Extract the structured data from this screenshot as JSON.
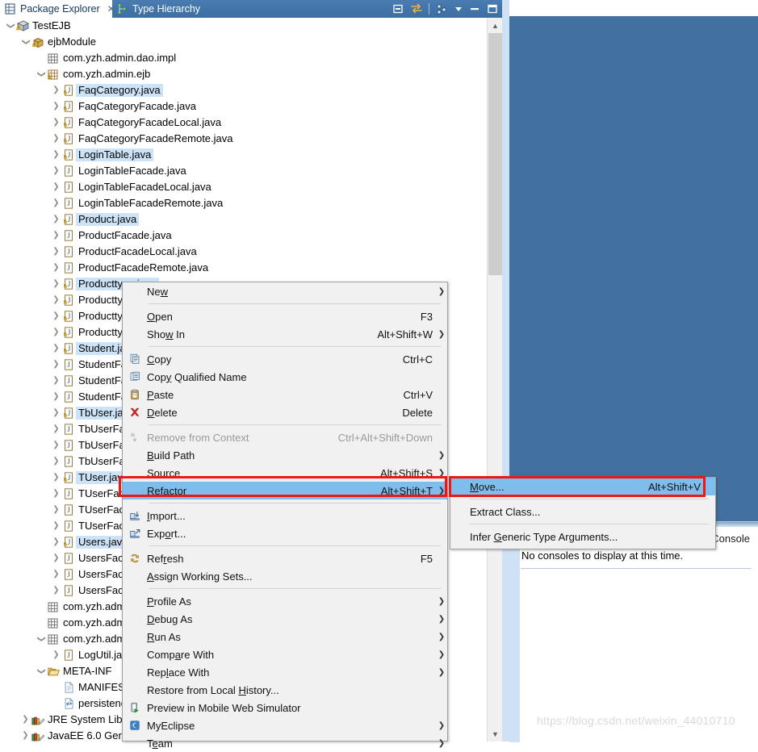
{
  "tabs": {
    "package_explorer": {
      "label": "Package Explorer",
      "icon": "package-explorer-icon",
      "close": "✕"
    },
    "type_hierarchy": {
      "label": "Type Hierarchy",
      "icon": "type-hierarchy-icon"
    },
    "toolbar": [
      {
        "name": "minimize-restore-icon",
        "glyph": "⊖"
      },
      {
        "name": "link-with-editor-icon",
        "glyph": "⇄"
      },
      {
        "name": "view-menu-hierarchy-icon",
        "glyph": "▣"
      },
      {
        "name": "view-menu-chevron-icon",
        "glyph": "▼"
      },
      {
        "name": "minimize-icon",
        "glyph": "−"
      },
      {
        "name": "maximize-icon",
        "glyph": "□"
      }
    ]
  },
  "tree": {
    "items": [
      {
        "depth": 0,
        "twisty": "v",
        "icon": "project-icon",
        "label": "TestEJB",
        "selected": false
      },
      {
        "depth": 1,
        "twisty": "v",
        "icon": "jar-icon",
        "label": "ejbModule",
        "selected": false
      },
      {
        "depth": 2,
        "twisty": "none",
        "icon": "package-icon",
        "label": "com.yzh.admin.dao.impl",
        "selected": false
      },
      {
        "depth": 2,
        "twisty": "v",
        "icon": "package-warn-icon",
        "label": "com.yzh.admin.ejb",
        "selected": false
      },
      {
        "depth": 3,
        "twisty": ">",
        "icon": "java-warn-icon",
        "label": "FaqCategory.java",
        "selected": true
      },
      {
        "depth": 3,
        "twisty": ">",
        "icon": "java-warn-icon",
        "label": "FaqCategoryFacade.java",
        "selected": false
      },
      {
        "depth": 3,
        "twisty": ">",
        "icon": "java-warn-icon",
        "label": "FaqCategoryFacadeLocal.java",
        "selected": false
      },
      {
        "depth": 3,
        "twisty": ">",
        "icon": "java-warn-icon",
        "label": "FaqCategoryFacadeRemote.java",
        "selected": false
      },
      {
        "depth": 3,
        "twisty": ">",
        "icon": "java-warn-icon",
        "label": "LoginTable.java",
        "selected": true
      },
      {
        "depth": 3,
        "twisty": ">",
        "icon": "java-icon",
        "label": "LoginTableFacade.java",
        "selected": false
      },
      {
        "depth": 3,
        "twisty": ">",
        "icon": "java-icon",
        "label": "LoginTableFacadeLocal.java",
        "selected": false
      },
      {
        "depth": 3,
        "twisty": ">",
        "icon": "java-icon",
        "label": "LoginTableFacadeRemote.java",
        "selected": false
      },
      {
        "depth": 3,
        "twisty": ">",
        "icon": "java-warn-icon",
        "label": "Product.java",
        "selected": true
      },
      {
        "depth": 3,
        "twisty": ">",
        "icon": "java-icon",
        "label": "ProductFacade.java",
        "selected": false
      },
      {
        "depth": 3,
        "twisty": ">",
        "icon": "java-icon",
        "label": "ProductFacadeLocal.java",
        "selected": false
      },
      {
        "depth": 3,
        "twisty": ">",
        "icon": "java-icon",
        "label": "ProductFacadeRemote.java",
        "selected": false
      },
      {
        "depth": 3,
        "twisty": ">",
        "icon": "java-warn-icon",
        "label": "Producttype.java",
        "selected": true
      },
      {
        "depth": 3,
        "twisty": ">",
        "icon": "java-warn-icon",
        "label": "ProducttypeFacade.java",
        "selected": false
      },
      {
        "depth": 3,
        "twisty": ">",
        "icon": "java-warn-icon",
        "label": "ProducttypeFacadeLocal.java",
        "selected": false
      },
      {
        "depth": 3,
        "twisty": ">",
        "icon": "java-warn-icon",
        "label": "ProducttypeFacadeRemote.java",
        "selected": false
      },
      {
        "depth": 3,
        "twisty": ">",
        "icon": "java-warn-icon",
        "label": "Student.java",
        "selected": true
      },
      {
        "depth": 3,
        "twisty": ">",
        "icon": "java-icon",
        "label": "StudentFacade.java",
        "selected": false
      },
      {
        "depth": 3,
        "twisty": ">",
        "icon": "java-icon",
        "label": "StudentFacadeLocal.java",
        "selected": false
      },
      {
        "depth": 3,
        "twisty": ">",
        "icon": "java-icon",
        "label": "StudentFacadeRemote.java",
        "selected": false
      },
      {
        "depth": 3,
        "twisty": ">",
        "icon": "java-warn-icon",
        "label": "TbUser.java",
        "selected": true
      },
      {
        "depth": 3,
        "twisty": ">",
        "icon": "java-icon",
        "label": "TbUserFacade.java",
        "selected": false
      },
      {
        "depth": 3,
        "twisty": ">",
        "icon": "java-icon",
        "label": "TbUserFacadeLocal.java",
        "selected": false
      },
      {
        "depth": 3,
        "twisty": ">",
        "icon": "java-icon",
        "label": "TbUserFacadeRemote.java",
        "selected": false
      },
      {
        "depth": 3,
        "twisty": ">",
        "icon": "java-warn-icon",
        "label": "TUser.java",
        "selected": true
      },
      {
        "depth": 3,
        "twisty": ">",
        "icon": "java-icon",
        "label": "TUserFacade.java",
        "selected": false
      },
      {
        "depth": 3,
        "twisty": ">",
        "icon": "java-icon",
        "label": "TUserFacadeLocal.java",
        "selected": false
      },
      {
        "depth": 3,
        "twisty": ">",
        "icon": "java-icon",
        "label": "TUserFacadeRemote.java",
        "selected": false
      },
      {
        "depth": 3,
        "twisty": ">",
        "icon": "java-warn-icon",
        "label": "Users.java",
        "selected": true
      },
      {
        "depth": 3,
        "twisty": ">",
        "icon": "java-icon",
        "label": "UsersFacade.java",
        "selected": false
      },
      {
        "depth": 3,
        "twisty": ">",
        "icon": "java-icon",
        "label": "UsersFacadeLocal.java",
        "selected": false
      },
      {
        "depth": 3,
        "twisty": ">",
        "icon": "java-icon",
        "label": "UsersFacadeRemote.java",
        "selected": false
      },
      {
        "depth": 2,
        "twisty": "none",
        "icon": "package-icon",
        "label": "com.yzh.admin.service",
        "selected": false
      },
      {
        "depth": 2,
        "twisty": "none",
        "icon": "package-icon",
        "label": "com.yzh.admin.service.impl",
        "selected": false
      },
      {
        "depth": 2,
        "twisty": "v",
        "icon": "package-icon",
        "label": "com.yzh.admin.util",
        "selected": false
      },
      {
        "depth": 3,
        "twisty": ">",
        "icon": "java-icon",
        "label": "LogUtil.java",
        "selected": false
      },
      {
        "depth": 2,
        "twisty": "v",
        "icon": "folder-icon",
        "label": "META-INF",
        "selected": false
      },
      {
        "depth": 3,
        "twisty": "none",
        "icon": "file-icon",
        "label": "MANIFEST.MF",
        "selected": false
      },
      {
        "depth": 3,
        "twisty": "none",
        "icon": "xml-file-icon",
        "label": "persistence.xml",
        "selected": false
      },
      {
        "depth": 1,
        "twisty": ">",
        "icon": "library-icon",
        "label": "JRE System Library",
        "selected": false
      },
      {
        "depth": 1,
        "twisty": ">",
        "icon": "library-icon",
        "label": "JavaEE 6.0 Generic Library",
        "selected": false
      }
    ]
  },
  "context_menu": {
    "items": [
      {
        "label": "New",
        "accel": "",
        "arrow": true,
        "icon": "",
        "sep_after": true,
        "disabled": false,
        "highlight": false,
        "mnemonic": 2
      },
      {
        "label": "Open",
        "accel": "F3",
        "arrow": false,
        "icon": "",
        "sep_after": false,
        "disabled": false,
        "highlight": false,
        "mnemonic": 0
      },
      {
        "label": "Show In",
        "accel": "Alt+Shift+W",
        "arrow": true,
        "icon": "",
        "sep_after": true,
        "disabled": false,
        "highlight": false,
        "mnemonic": 3
      },
      {
        "label": "Copy",
        "accel": "Ctrl+C",
        "arrow": false,
        "icon": "copy-icon",
        "sep_after": false,
        "disabled": false,
        "highlight": false,
        "mnemonic": 0
      },
      {
        "label": "Copy Qualified Name",
        "accel": "",
        "arrow": false,
        "icon": "copy-qualified-icon",
        "sep_after": false,
        "disabled": false,
        "highlight": false,
        "mnemonic": 3
      },
      {
        "label": "Paste",
        "accel": "Ctrl+V",
        "arrow": false,
        "icon": "paste-icon",
        "sep_after": false,
        "disabled": false,
        "highlight": false,
        "mnemonic": 0
      },
      {
        "label": "Delete",
        "accel": "Delete",
        "arrow": false,
        "icon": "delete-icon",
        "sep_after": true,
        "disabled": false,
        "highlight": false,
        "mnemonic": 0
      },
      {
        "label": "Remove from Context",
        "accel": "Ctrl+Alt+Shift+Down",
        "arrow": false,
        "icon": "remove-context-icon",
        "sep_after": false,
        "disabled": true,
        "highlight": false,
        "mnemonic": -1
      },
      {
        "label": "Build Path",
        "accel": "",
        "arrow": true,
        "icon": "",
        "sep_after": false,
        "disabled": false,
        "highlight": false,
        "mnemonic": 0
      },
      {
        "label": "Source",
        "accel": "Alt+Shift+S",
        "arrow": true,
        "icon": "",
        "sep_after": false,
        "disabled": false,
        "highlight": false,
        "mnemonic": 0
      },
      {
        "label": "Refactor",
        "accel": "Alt+Shift+T",
        "arrow": true,
        "icon": "",
        "sep_after": true,
        "disabled": false,
        "highlight": true,
        "mnemonic": 6
      },
      {
        "label": "Import...",
        "accel": "",
        "arrow": false,
        "icon": "import-icon",
        "sep_after": false,
        "disabled": false,
        "highlight": false,
        "mnemonic": 0
      },
      {
        "label": "Export...",
        "accel": "",
        "arrow": false,
        "icon": "export-icon",
        "sep_after": true,
        "disabled": false,
        "highlight": false,
        "mnemonic": 3
      },
      {
        "label": "Refresh",
        "accel": "F5",
        "arrow": false,
        "icon": "refresh-icon",
        "sep_after": false,
        "disabled": false,
        "highlight": false,
        "mnemonic": 3
      },
      {
        "label": "Assign Working Sets...",
        "accel": "",
        "arrow": false,
        "icon": "",
        "sep_after": true,
        "disabled": false,
        "highlight": false,
        "mnemonic": 0
      },
      {
        "label": "Profile As",
        "accel": "",
        "arrow": true,
        "icon": "",
        "sep_after": false,
        "disabled": false,
        "highlight": false,
        "mnemonic": 0
      },
      {
        "label": "Debug As",
        "accel": "",
        "arrow": true,
        "icon": "",
        "sep_after": false,
        "disabled": false,
        "highlight": false,
        "mnemonic": 0
      },
      {
        "label": "Run As",
        "accel": "",
        "arrow": true,
        "icon": "",
        "sep_after": false,
        "disabled": false,
        "highlight": false,
        "mnemonic": 0
      },
      {
        "label": "Compare With",
        "accel": "",
        "arrow": true,
        "icon": "",
        "sep_after": false,
        "disabled": false,
        "highlight": false,
        "mnemonic": 4
      },
      {
        "label": "Replace With",
        "accel": "",
        "arrow": true,
        "icon": "",
        "sep_after": false,
        "disabled": false,
        "highlight": false,
        "mnemonic": 3
      },
      {
        "label": "Restore from Local History...",
        "accel": "",
        "arrow": false,
        "icon": "",
        "sep_after": false,
        "disabled": false,
        "highlight": false,
        "mnemonic": 19
      },
      {
        "label": "Preview in Mobile Web Simulator",
        "accel": "",
        "arrow": false,
        "icon": "mobile-preview-icon",
        "sep_after": false,
        "disabled": false,
        "highlight": false,
        "mnemonic": -1
      },
      {
        "label": "MyEclipse",
        "accel": "",
        "arrow": true,
        "icon": "myeclipse-icon",
        "sep_after": false,
        "disabled": false,
        "highlight": false,
        "mnemonic": -1
      },
      {
        "label": "Team",
        "accel": "",
        "arrow": true,
        "icon": "",
        "sep_after": false,
        "disabled": false,
        "highlight": false,
        "mnemonic": 1
      }
    ]
  },
  "submenu": {
    "items": [
      {
        "label": "Move...",
        "accel": "Alt+Shift+V",
        "sep_after": true,
        "highlight": true,
        "mnemonic": 0
      },
      {
        "label": "Extract Class...",
        "accel": "",
        "sep_after": true,
        "highlight": false,
        "mnemonic": -1
      },
      {
        "label": "Infer Generic Type Arguments...",
        "accel": "",
        "sep_after": false,
        "highlight": false,
        "mnemonic": 6
      }
    ]
  },
  "console": {
    "tab_label": "Console",
    "message": "No consoles to display at this time."
  },
  "watermark": "https://blog.csdn.net/weixin_44010710",
  "scrollbar": {
    "up": "▲",
    "down": "▼"
  },
  "colors": {
    "tab_active": "#43719f",
    "selection": "#cde3f7",
    "menu_highlight": "#7fbdec",
    "red_box": "#ef1616",
    "editor_blue": "#43719f"
  }
}
